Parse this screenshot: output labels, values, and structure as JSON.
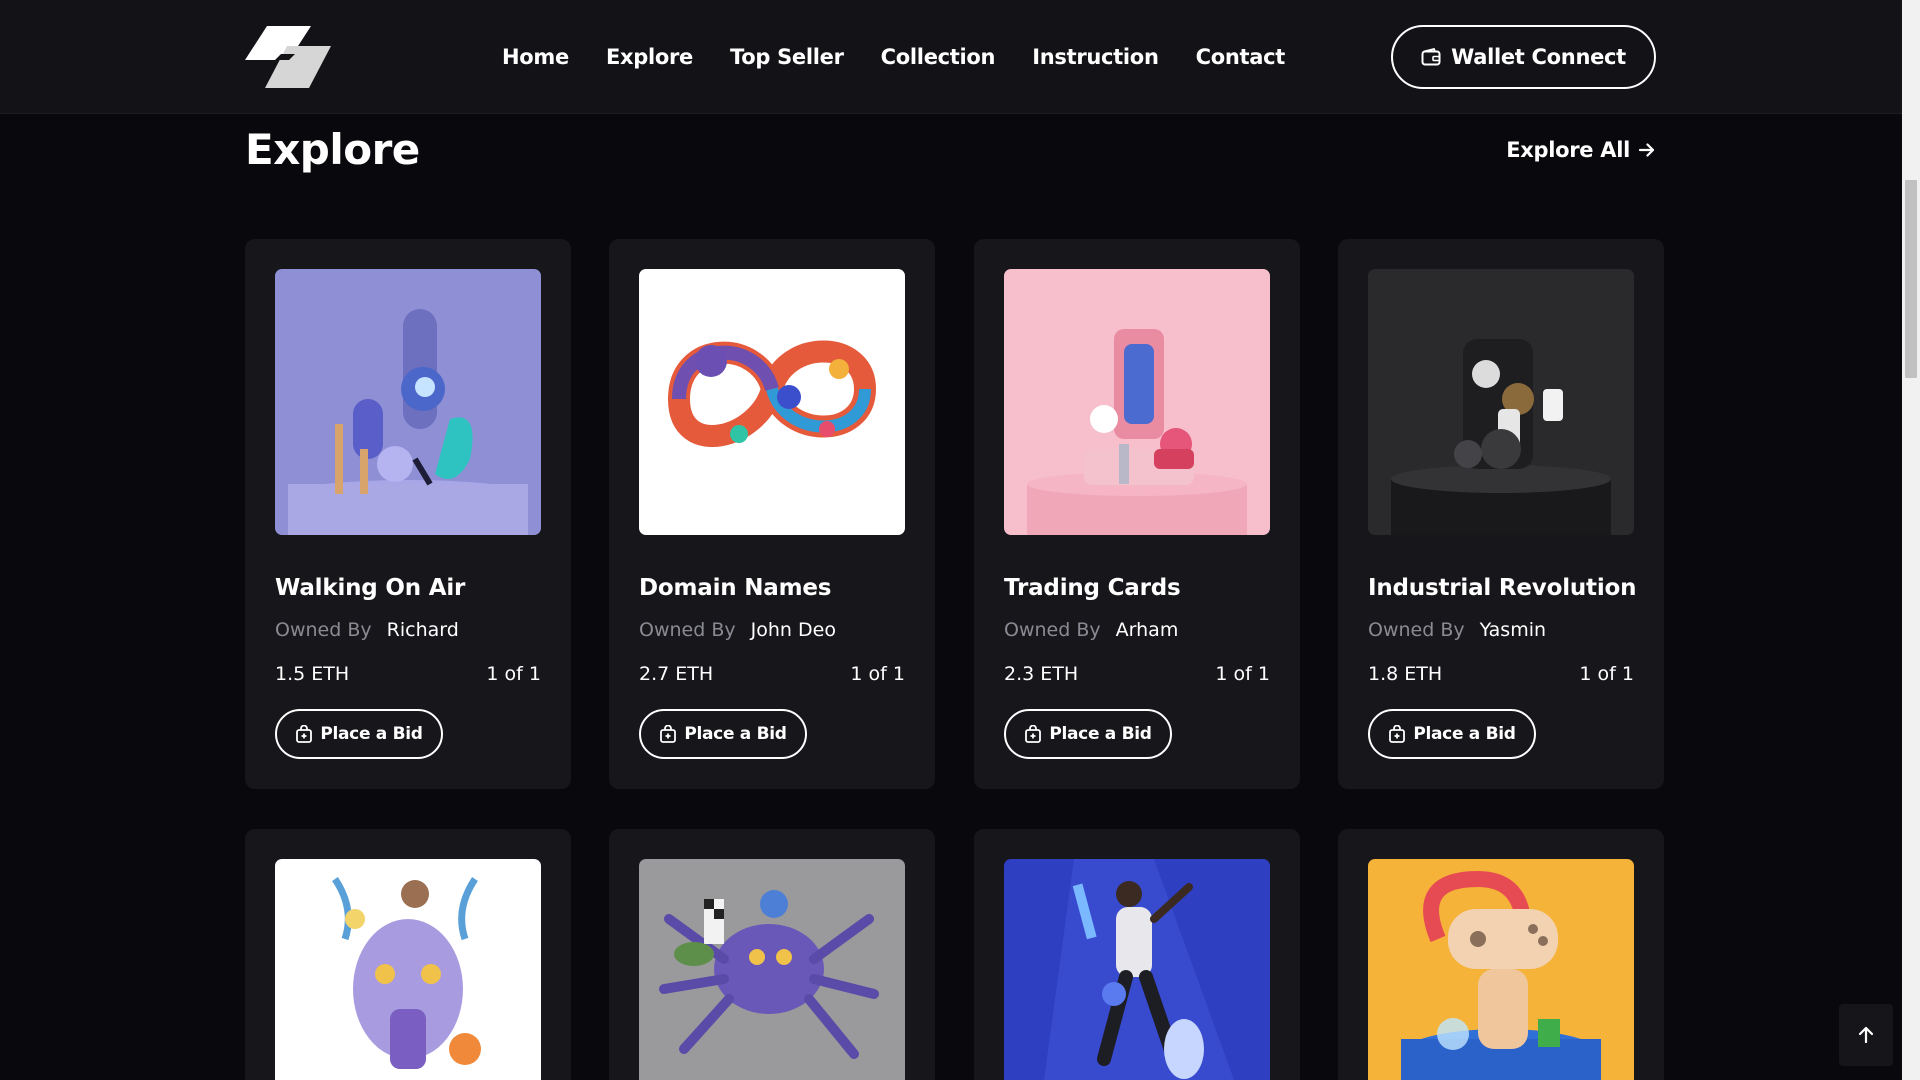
{
  "nav": {
    "items": [
      {
        "label": "Home"
      },
      {
        "label": "Explore"
      },
      {
        "label": "Top Seller"
      },
      {
        "label": "Collection"
      },
      {
        "label": "Instruction"
      },
      {
        "label": "Contact"
      }
    ],
    "wallet_label": "Wallet Connect",
    "logo_icon": "brand-parallelogram-logo",
    "wallet_icon": "wallet-icon"
  },
  "section": {
    "title": "Explore",
    "explore_all_label": "Explore All",
    "explore_all_icon": "arrow-right-icon"
  },
  "cards": [
    {
      "name": "Walking On Air",
      "owned_by_label": "Owned By",
      "owner": "Richard",
      "price": "1.5 ETH",
      "edition": "1 of 1",
      "bid_label": "Place a Bid",
      "thumb_bg": "#8f8fd6"
    },
    {
      "name": "Domain Names",
      "owned_by_label": "Owned By",
      "owner": "John Deo",
      "price": "2.7 ETH",
      "edition": "1 of 1",
      "bid_label": "Place a Bid",
      "thumb_bg": "#ffffff"
    },
    {
      "name": "Trading Cards",
      "owned_by_label": "Owned By",
      "owner": "Arham",
      "price": "2.3 ETH",
      "edition": "1 of 1",
      "bid_label": "Place a Bid",
      "thumb_bg": "#f7bfcc"
    },
    {
      "name": "Industrial Revolution",
      "owned_by_label": "Owned By",
      "owner": "Yasmin",
      "price": "1.8 ETH",
      "edition": "1 of 1",
      "bid_label": "Place a Bid",
      "thumb_bg": "#2a2a2c"
    }
  ],
  "cards_row2": [
    {
      "thumb_bg": "#ffffff"
    },
    {
      "thumb_bg": "#9a9a9c"
    },
    {
      "thumb_bg": "#2f3fc2"
    },
    {
      "thumb_bg": "#f5b33a"
    }
  ],
  "back_to_top_icon": "arrow-up-icon",
  "colors": {
    "page_bg": "#09090d",
    "header_bg": "#131317",
    "card_bg": "#17171b",
    "muted_text": "#8a8a93"
  }
}
